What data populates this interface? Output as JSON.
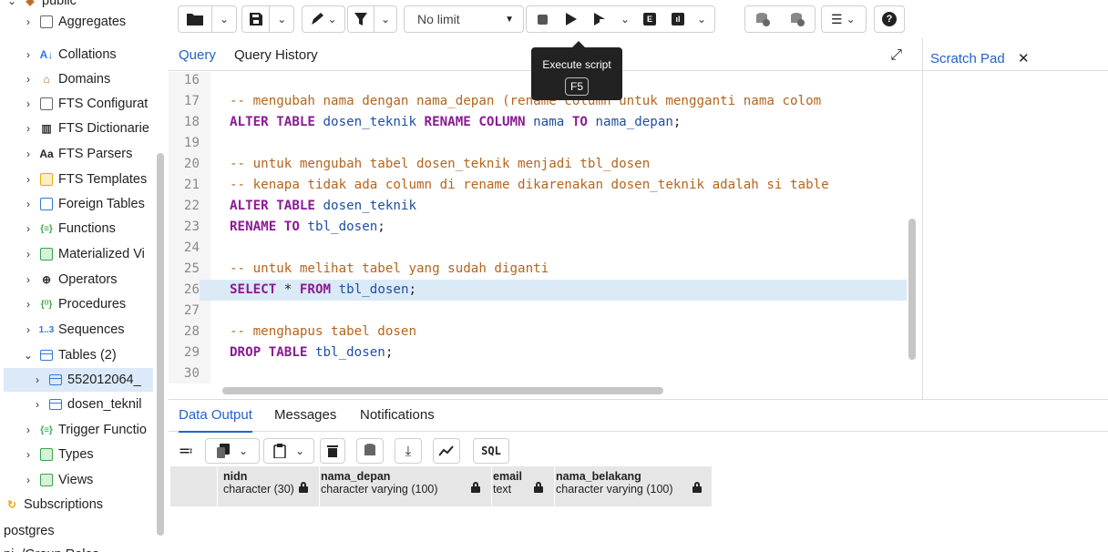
{
  "tree": {
    "items": [
      {
        "label": "public",
        "icon": "schema-icon",
        "chevron": "⌄",
        "partial": true
      },
      {
        "label": "Aggregates",
        "icon": "aggregates-icon",
        "chevron": "›"
      },
      {
        "label": "Collations",
        "icon": "collations-icon",
        "chevron": "›"
      },
      {
        "label": "Domains",
        "icon": "domains-icon",
        "chevron": "›"
      },
      {
        "label": "FTS Configurat",
        "icon": "fts-config-icon",
        "chevron": "›"
      },
      {
        "label": "FTS Dictionarie",
        "icon": "fts-dictionary-icon",
        "chevron": "›"
      },
      {
        "label": "FTS Parsers",
        "icon": "fts-parser-icon",
        "chevron": "›"
      },
      {
        "label": "FTS Templates",
        "icon": "fts-template-icon",
        "chevron": "›"
      },
      {
        "label": "Foreign Tables",
        "icon": "foreign-table-icon",
        "chevron": "›"
      },
      {
        "label": "Functions",
        "icon": "functions-icon",
        "chevron": "›"
      },
      {
        "label": "Materialized Vi",
        "icon": "materialized-view-icon",
        "chevron": "›"
      },
      {
        "label": "Operators",
        "icon": "operators-icon",
        "chevron": "›"
      },
      {
        "label": "Procedures",
        "icon": "procedures-icon",
        "chevron": "›"
      },
      {
        "label": "Sequences",
        "icon": "sequences-icon",
        "chevron": "›"
      },
      {
        "label": "Tables (2)",
        "icon": "tables-icon",
        "chevron": "⌄"
      },
      {
        "label": "552012064_",
        "icon": "table-icon",
        "chevron": "›",
        "selected": true
      },
      {
        "label": "dosen_teknil",
        "icon": "table-icon",
        "chevron": "›"
      },
      {
        "label": "Trigger Functio",
        "icon": "trigger-function-icon",
        "chevron": "›"
      },
      {
        "label": "Types",
        "icon": "types-icon",
        "chevron": "›"
      },
      {
        "label": "Views",
        "icon": "views-icon",
        "chevron": "›"
      },
      {
        "label": "Subscriptions",
        "icon": "subscriptions-icon",
        "chevron": ""
      },
      {
        "label": "postgres",
        "icon": "",
        "chevron": ""
      },
      {
        "label": "pj_/Group Roles",
        "icon": "",
        "chevron": "",
        "partial": true
      }
    ]
  },
  "toolbar": {
    "limit_label": "No limit",
    "tooltip_title": "Execute script",
    "tooltip_key": "F5"
  },
  "query": {
    "tab_query": "Query",
    "tab_history": "Query History",
    "expand_icon": "expand-icon",
    "lines": [
      {
        "n": "16",
        "tokens": []
      },
      {
        "n": "17",
        "tokens": [
          {
            "t": "cm",
            "v": "-- mengubah nama dengan nama_depan (rename column untuk mengganti nama colom"
          }
        ]
      },
      {
        "n": "18",
        "tokens": [
          {
            "t": "kw",
            "v": "ALTER TABLE "
          },
          {
            "t": "id",
            "v": "dosen_teknik "
          },
          {
            "t": "kw",
            "v": "RENAME COLUMN "
          },
          {
            "t": "id",
            "v": "nama "
          },
          {
            "t": "kw",
            "v": "TO "
          },
          {
            "t": "id",
            "v": "nama_depan"
          },
          {
            "t": "op",
            "v": ";"
          }
        ]
      },
      {
        "n": "19",
        "tokens": []
      },
      {
        "n": "20",
        "tokens": [
          {
            "t": "cm",
            "v": "-- untuk mengubah tabel dosen_teknik menjadi tbl_dosen"
          }
        ]
      },
      {
        "n": "21",
        "tokens": [
          {
            "t": "cm",
            "v": "-- kenapa tidak ada column di rename dikarenakan dosen_teknik adalah si table"
          }
        ]
      },
      {
        "n": "22",
        "tokens": [
          {
            "t": "kw",
            "v": "ALTER TABLE "
          },
          {
            "t": "id",
            "v": "dosen_teknik"
          }
        ]
      },
      {
        "n": "23",
        "tokens": [
          {
            "t": "kw",
            "v": "RENAME TO "
          },
          {
            "t": "id",
            "v": "tbl_dosen"
          },
          {
            "t": "op",
            "v": ";"
          }
        ]
      },
      {
        "n": "24",
        "tokens": []
      },
      {
        "n": "25",
        "tokens": [
          {
            "t": "cm",
            "v": "-- untuk melihat tabel yang sudah diganti"
          }
        ]
      },
      {
        "n": "26",
        "tokens": [
          {
            "t": "kw",
            "v": "SELECT "
          },
          {
            "t": "op",
            "v": "* "
          },
          {
            "t": "kw",
            "v": "FROM "
          },
          {
            "t": "id",
            "v": "tbl_dosen"
          },
          {
            "t": "op",
            "v": ";"
          }
        ],
        "highlight": true
      },
      {
        "n": "27",
        "tokens": []
      },
      {
        "n": "28",
        "tokens": [
          {
            "t": "cm",
            "v": "-- menghapus tabel dosen"
          }
        ]
      },
      {
        "n": "29",
        "tokens": [
          {
            "t": "kw",
            "v": "DROP TABLE "
          },
          {
            "t": "id",
            "v": "tbl_dosen"
          },
          {
            "t": "op",
            "v": ";"
          }
        ]
      },
      {
        "n": "30",
        "tokens": []
      }
    ]
  },
  "scratch": {
    "label": "Scratch Pad",
    "close": "✕"
  },
  "results": {
    "tab_data": "Data Output",
    "tab_messages": "Messages",
    "tab_notifications": "Notifications",
    "sql_label": "SQL",
    "columns": [
      {
        "name": "nidn",
        "type": "character (30)"
      },
      {
        "name": "nama_depan",
        "type": "character varying (100)"
      },
      {
        "name": "email",
        "type": "text"
      },
      {
        "name": "nama_belakang",
        "type": "character varying (100)"
      }
    ]
  },
  "colors": {
    "accent": "#2462c9",
    "keyword": "#8a1a94",
    "identifier": "#1f4fa3",
    "comment": "#b5651d",
    "highlight_line": "#dbeaf7"
  }
}
